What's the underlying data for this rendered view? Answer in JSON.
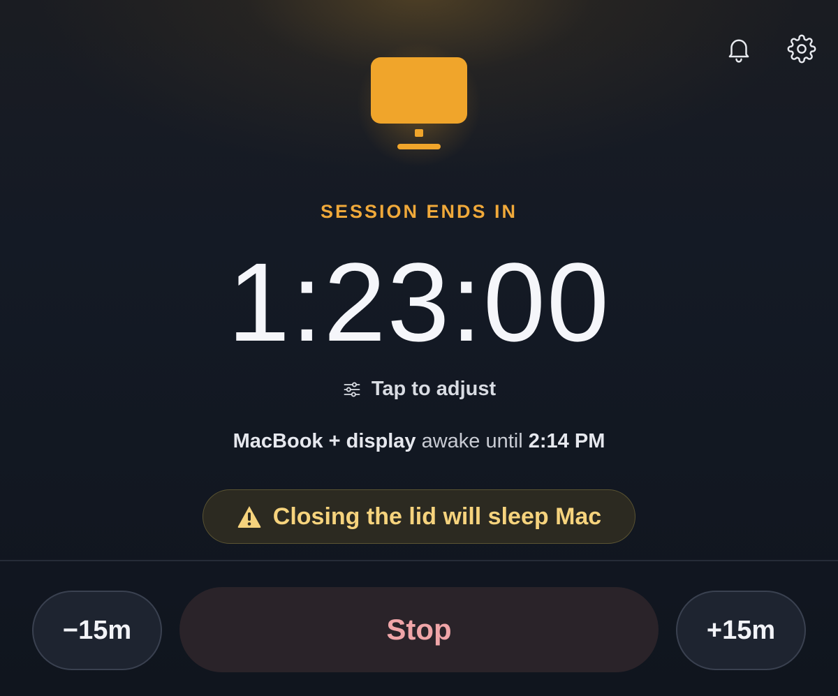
{
  "header": {
    "notifications_icon": "bell-icon",
    "settings_icon": "gear-icon"
  },
  "hero": {
    "icon": "monitor-icon",
    "accent_color": "#f0a93a"
  },
  "session": {
    "label": "SESSION ENDS IN",
    "remaining": "1:23:00",
    "adjust_label": "Tap to adjust",
    "adjust_icon": "sliders-icon"
  },
  "status": {
    "device": "MacBook",
    "plus": " + ",
    "component": "display",
    "middle": " awake until ",
    "until_time": "2:14 PM"
  },
  "warning": {
    "icon": "warning-icon",
    "text": "Closing the lid will sleep Mac"
  },
  "controls": {
    "minus_label": "−15m",
    "stop_label": "Stop",
    "plus_label": "+15m"
  }
}
